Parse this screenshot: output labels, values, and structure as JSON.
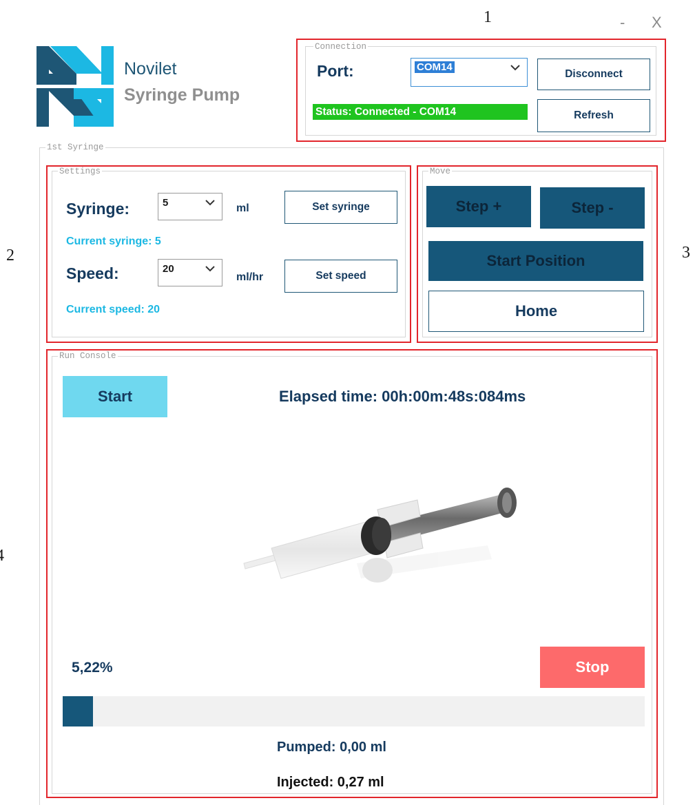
{
  "annotations": {
    "n1": "1",
    "n2": "2",
    "n3": "3",
    "n4": "4"
  },
  "window": {
    "minimize": "-",
    "close": "X"
  },
  "brand": {
    "name": "Novilet",
    "product": "Syringe Pump"
  },
  "connection": {
    "legend": "Connection",
    "port_label": "Port:",
    "port_value": "COM14",
    "disconnect_label": "Disconnect",
    "refresh_label": "Refresh",
    "status_text": "Status: Connected - COM14"
  },
  "syringe_group": {
    "legend": "1st Syringe"
  },
  "settings": {
    "legend": "Settings",
    "syringe_label": "Syringe:",
    "syringe_value": "5",
    "syringe_unit": "ml",
    "set_syringe_label": "Set syringe",
    "current_syringe": "Current syringe: 5",
    "speed_label": "Speed:",
    "speed_value": "20",
    "speed_unit": "ml/hr",
    "set_speed_label": "Set speed",
    "current_speed": "Current speed: 20"
  },
  "move": {
    "legend": "Move",
    "step_plus": "Step +",
    "step_minus": "Step -",
    "start_position": "Start Position",
    "home": "Home"
  },
  "console": {
    "legend": "Run Console",
    "start_label": "Start",
    "elapsed_time": "Elapsed time: 00h:00m:48s:084ms",
    "percent_text": "5,22%",
    "progress_fraction": 0.0522,
    "stop_label": "Stop",
    "pumped": "Pumped: 0,00 ml",
    "injected": "Injected: 0,27 ml"
  },
  "colors": {
    "annotation_red": "#e2252b",
    "dark_teal": "#16577a",
    "navy_text": "#153a5e",
    "cyan_text": "#1cb8e3",
    "start_button": "#6fd8ef",
    "stop_button": "#fd6a6b",
    "status_green": "#1fc41f"
  },
  "icons": {
    "logo": "novilet-logo",
    "dropdown": "chevron-down-icon",
    "syringe_image": "syringe-image"
  }
}
